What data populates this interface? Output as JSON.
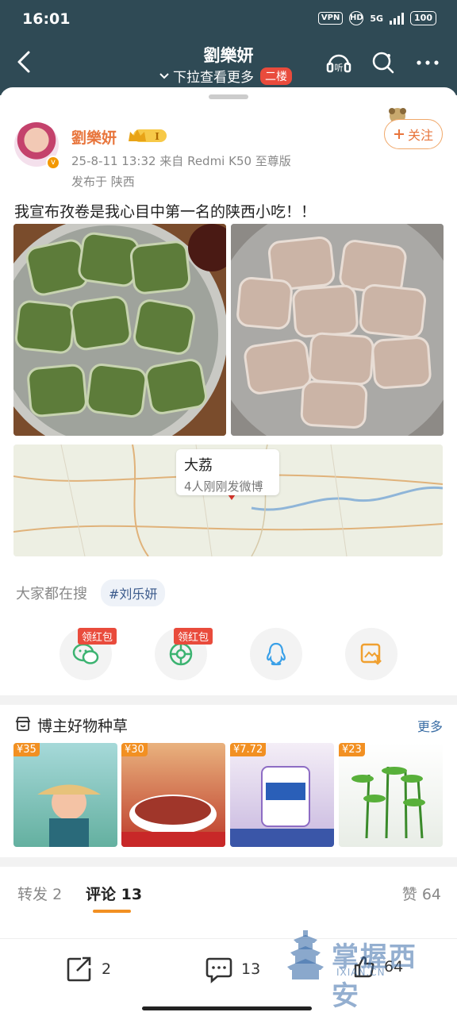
{
  "status": {
    "time": "16:01",
    "vpn": "VPN",
    "hd": "HD",
    "net": "5G",
    "battery": "100"
  },
  "nav": {
    "title": "劉樂妍",
    "subtitle": "下拉查看更多",
    "badge": "二楼"
  },
  "post": {
    "username": "劉樂妍",
    "meta": "25-8-11 13:32  来自 Redmi K50 至尊版",
    "location": "发布于 陕西",
    "follow_label": "关注",
    "text": "我宣布孜卷是我心目中第一名的陕西小吃！！",
    "map": {
      "place": "大荔",
      "sub": "4人刚刚发微博"
    },
    "hot_search_label": "大家都在搜",
    "hot_tag": "#刘乐妍"
  },
  "share": {
    "redpack": "领红包"
  },
  "goods": {
    "title": "博主好物种草",
    "more": "更多",
    "items": [
      {
        "price": "¥35"
      },
      {
        "price": "¥30"
      },
      {
        "price": "¥7.72"
      },
      {
        "price": "¥23"
      }
    ]
  },
  "tabs": {
    "repost": "转发",
    "repost_count": "2",
    "comment": "评论",
    "comment_count": "13",
    "like": "赞",
    "like_count": "64"
  },
  "bottom": {
    "repost_count": "2",
    "comment_count": "13",
    "like_count": "64"
  },
  "watermark": {
    "text": "掌握西安",
    "url": "IXIAN.CN"
  }
}
